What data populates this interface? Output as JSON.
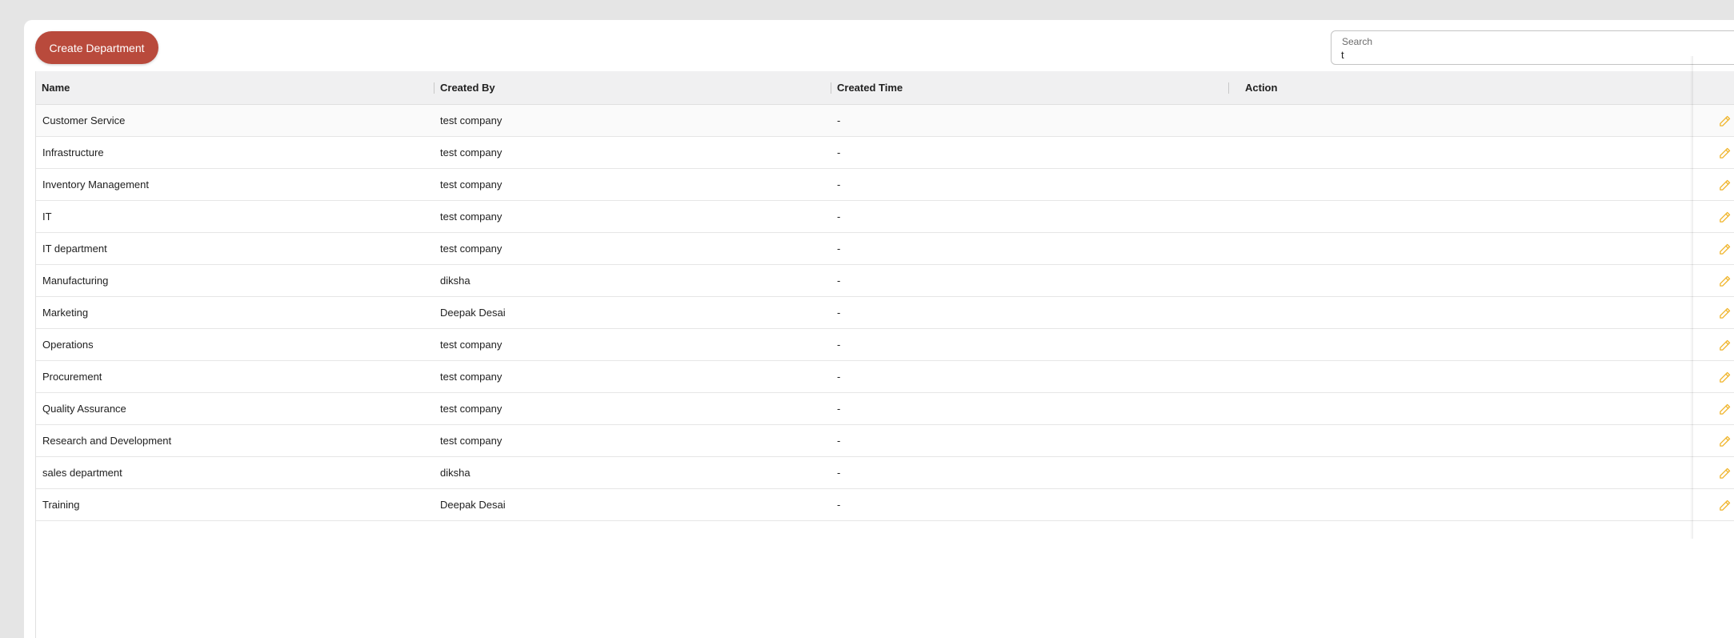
{
  "toolbar": {
    "create_label": "Create Department"
  },
  "search": {
    "label": "Search",
    "value": "t"
  },
  "table": {
    "columns": {
      "name": "Name",
      "created_by": "Created By",
      "created_time": "Created Time",
      "action": "Action"
    },
    "rows": [
      {
        "name": "Customer Service",
        "created_by": "test company",
        "created_time": "-"
      },
      {
        "name": "Infrastructure",
        "created_by": "test company",
        "created_time": "-"
      },
      {
        "name": "Inventory Management",
        "created_by": "test company",
        "created_time": "-"
      },
      {
        "name": "IT",
        "created_by": "test company",
        "created_time": "-"
      },
      {
        "name": "IT department",
        "created_by": "test company",
        "created_time": "-"
      },
      {
        "name": "Manufacturing",
        "created_by": "diksha",
        "created_time": "-"
      },
      {
        "name": "Marketing",
        "created_by": "Deepak Desai",
        "created_time": "-"
      },
      {
        "name": "Operations",
        "created_by": "test company",
        "created_time": "-"
      },
      {
        "name": "Procurement",
        "created_by": "test company",
        "created_time": "-"
      },
      {
        "name": "Quality Assurance",
        "created_by": "test company",
        "created_time": "-"
      },
      {
        "name": "Research and Development",
        "created_by": "test company",
        "created_time": "-"
      },
      {
        "name": "sales department",
        "created_by": "diksha",
        "created_time": "-"
      },
      {
        "name": "Training",
        "created_by": "Deepak Desai",
        "created_time": "-"
      }
    ]
  },
  "icons": {
    "edit": "pencil-icon"
  },
  "colors": {
    "primary_button": "#b94a3c",
    "edit_icon": "#f0b429",
    "header_bg": "#f0f0f1"
  }
}
